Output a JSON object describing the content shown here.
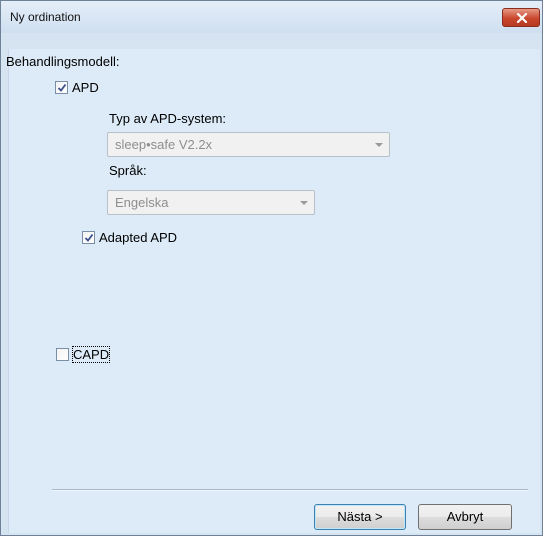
{
  "window": {
    "title": "Ny ordination"
  },
  "form": {
    "treatment_model_label": "Behandlingsmodell:",
    "apd": {
      "label": "APD",
      "checked": true
    },
    "apd_system": {
      "label": "Typ av APD-system:",
      "value": "sleep•safe V2.2x",
      "enabled": false
    },
    "language": {
      "label": "Språk:",
      "value": "Engelska",
      "enabled": false
    },
    "adapted_apd": {
      "label": "Adapted APD",
      "checked": true
    },
    "capd": {
      "label": "CAPD",
      "checked": false
    }
  },
  "buttons": {
    "next": "Nästa >",
    "cancel": "Avbryt"
  },
  "icons": {
    "close": "close-icon",
    "checkmark": "checkmark-icon",
    "dropdown": "chevron-down-icon"
  },
  "colors": {
    "client_bg": "#dcebf7",
    "close_button": "#c9482e",
    "checkmark": "#3a4f8a"
  }
}
